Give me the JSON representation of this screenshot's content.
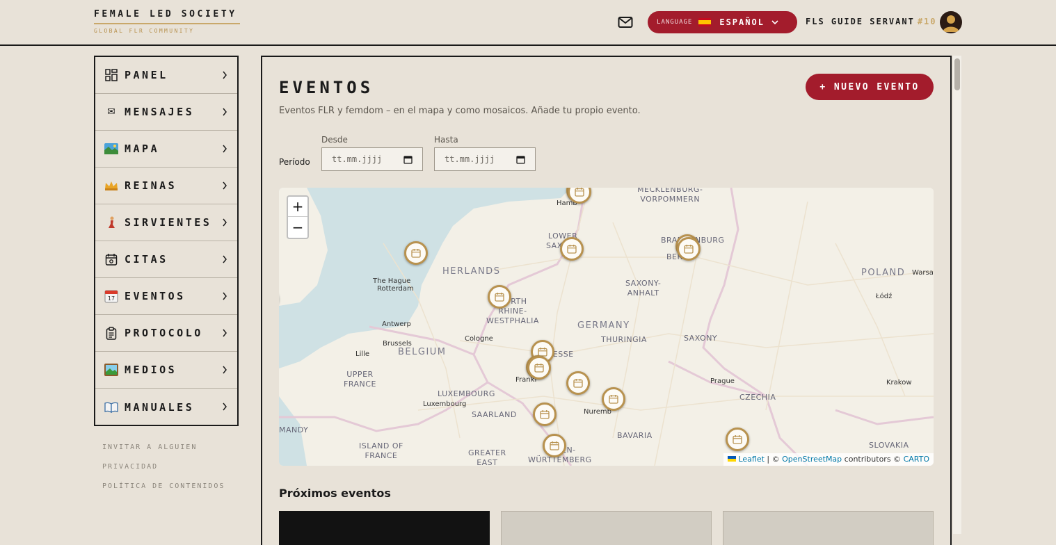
{
  "brand": {
    "title": "FEMALE LED SOCIETY",
    "subtitle": "GLOBAL FLR COMMUNITY"
  },
  "header": {
    "mail_icon": "mail-icon",
    "language_label": "LANGUAGE",
    "language_value": "ESPAÑOL",
    "user_name": "FLS GUIDE SERVANT",
    "user_rank": "#10"
  },
  "colors": {
    "accent": "#a31c2c",
    "gold": "#c9a86a",
    "background": "#e8e2d8"
  },
  "sidebar": {
    "items": [
      {
        "label": "PANEL",
        "icon": "dashboard-icon"
      },
      {
        "label": "MENSAJES",
        "icon": "envelope-icon"
      },
      {
        "label": "MAPA",
        "icon": "map-icon"
      },
      {
        "label": "REINAS",
        "icon": "crown-icon"
      },
      {
        "label": "SIRVIENTES",
        "icon": "kneeling-person-icon"
      },
      {
        "label": "CITAS",
        "icon": "calendar-check-icon"
      },
      {
        "label": "EVENTOS",
        "icon": "calendar-icon"
      },
      {
        "label": "PROTOCOLO",
        "icon": "clipboard-icon"
      },
      {
        "label": "MEDIOS",
        "icon": "picture-icon"
      },
      {
        "label": "MANUALES",
        "icon": "book-icon"
      }
    ],
    "footer_links": [
      "INVITAR A ALGUIEN",
      "PRIVACIDAD",
      "POLÍTICA DE CONTENIDOS"
    ]
  },
  "main": {
    "title": "EVENTOS",
    "subtitle": "Eventos FLR y femdom – en el mapa y como mosaicos. Añade tu propio evento.",
    "new_button": "+ NUEVO EVENTO",
    "period_label": "Período",
    "from_label": "Desde",
    "to_label": "Hasta",
    "from_placeholder": "tt.mm.jjjj",
    "to_placeholder": "tt.mm.jjjj",
    "upcoming_title": "Próximos eventos"
  },
  "map": {
    "zoom_in": "+",
    "zoom_out": "−",
    "labels": {
      "mecklenburg": "MECKLENBURG-\nVORPOMMERN",
      "hamburg": "Hamb",
      "lower_saxony": "LOWER\nSAXONY",
      "brandenburg": "BRANDENBURG",
      "berlin": "BERL",
      "netherlands": "HERLANDS",
      "the_hague": "The Hague",
      "rotterdam": "Rotterdam",
      "poland": "POLAND",
      "warsaw": "Warsa",
      "lodz": "Łódź",
      "saxony_anhalt": "SAXONY-\nANHALT",
      "nrw": "NORTH\nRHINE-\nWESTPHALIA",
      "antwerp": "Antwerp",
      "germany": "GERMANY",
      "thuringia": "THURINGIA",
      "cologne": "Cologne",
      "saxony": "SAXONY",
      "brussels": "Brussels",
      "belgium": "BELGIUM",
      "lille": "Lille",
      "hesse": "HESSE",
      "upper_france": "UPPER\nFRANCE",
      "frankfurt": "Frankf",
      "prague": "Prague",
      "krakow": "Krakow",
      "luxembourg": "LUXEMBOURG",
      "luxembourg_city": "Luxembourg",
      "czechia": "CZECHIA",
      "nuremberg": "Nuremb",
      "saarland": "SAARLAND",
      "normandy": "MANDY",
      "bavaria": "BAVARIA",
      "island_of_france": "ISLAND OF\nFRANCE",
      "greater_east": "GREATER\nEAST",
      "baden_wurttemberg": "BADEN-\nWÜRTTEMBERG",
      "slovakia": "SLOVAKIA"
    },
    "attribution": {
      "leaflet": "Leaflet",
      "sep1": " | © ",
      "osm": "OpenStreetMap",
      "mid": " contributors © ",
      "carto": "CARTO"
    }
  }
}
